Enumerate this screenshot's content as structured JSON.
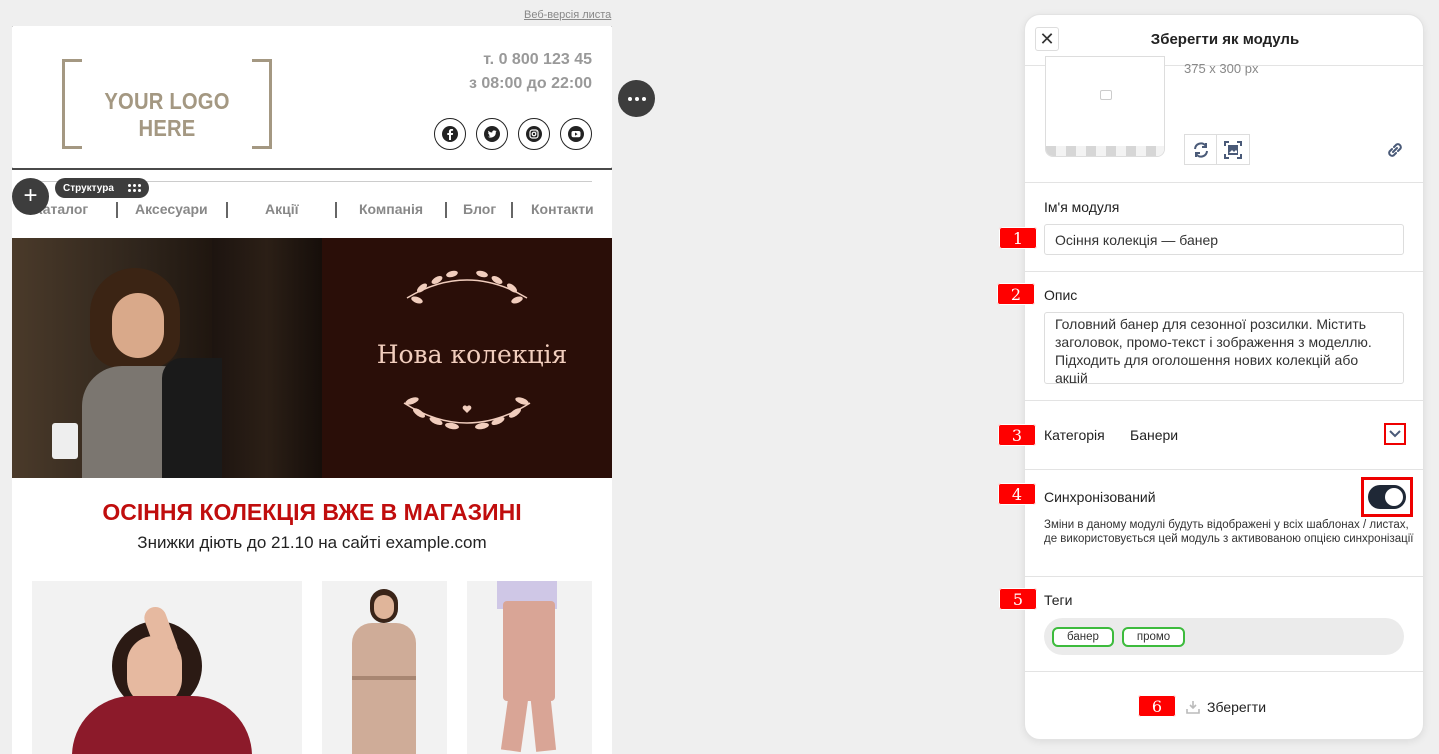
{
  "email": {
    "web_version_link": "Веб-версія листа",
    "logo_text": "YOUR LOGO HERE",
    "phone": "т. 0 800 123 45",
    "hours": "з 08:00 до 22:00",
    "socials": [
      "facebook-icon",
      "twitter-icon",
      "instagram-icon",
      "youtube-icon"
    ],
    "structure_chip": "Структура",
    "nav": [
      "Каталог",
      "Аксесуари",
      "Акції",
      "Компанія",
      "Блог",
      "Контакти"
    ],
    "banner_title": "Нова колекція",
    "headline": "ОСІННЯ КОЛЕКЦІЯ ВЖЕ В МАГАЗИНІ",
    "subline": "Знижки діють до 21.10 на сайті example.com"
  },
  "panel": {
    "title": "Зберегти як модуль",
    "dimensions": "375 x 300 px",
    "module_name_label": "Ім'я модуля",
    "module_name_value": "Осіння колекція — банер",
    "description_label": "Опис",
    "description_value": "Головний банер для сезонної розсилки. Містить заголовок, промо-текст і зображення з моделлю. Підходить для оголошення нових колекцій або акцій",
    "category_label": "Категорія",
    "category_value": "Банери",
    "sync_label": "Синхронізований",
    "sync_on": true,
    "sync_hint": "Зміни в даному модулі будуть відображені у всіх шаблонах / листах, де використовується цей модуль з активованою опцією синхронізації",
    "tags_label": "Теги",
    "tags": [
      "банер",
      "промо"
    ],
    "save_label": "Зберегти"
  },
  "markers": [
    "1",
    "2",
    "3",
    "4",
    "5",
    "6"
  ],
  "colors": {
    "headline_red": "#c00d0d",
    "marker_red": "#ff0000",
    "tag_green": "#3dbb3d",
    "toggle_dark": "#1f2836"
  }
}
